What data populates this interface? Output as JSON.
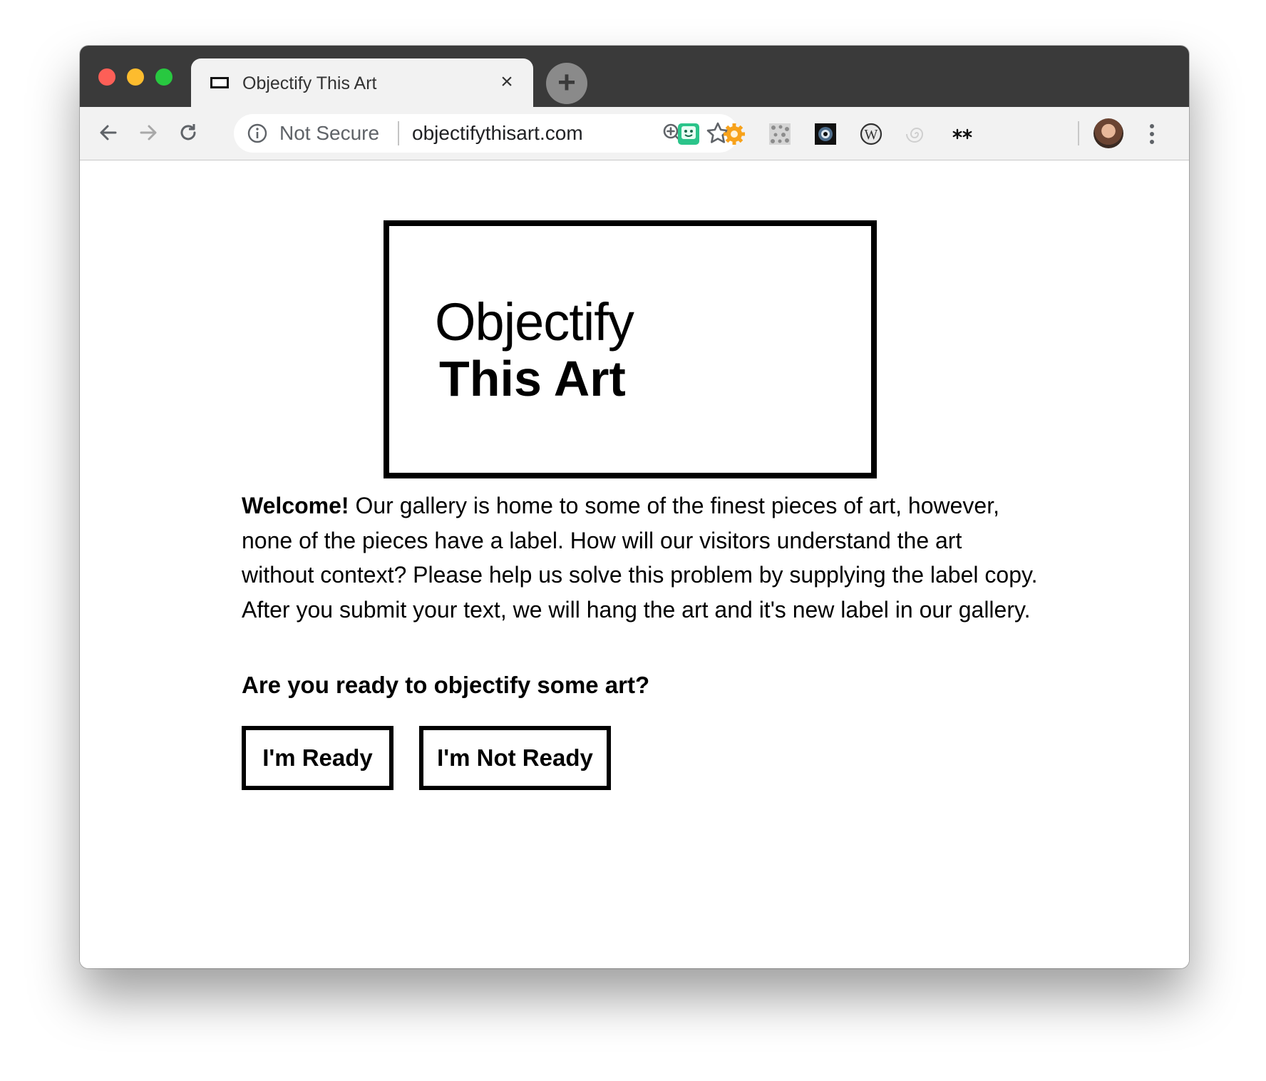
{
  "browser": {
    "tab": {
      "title": "Objectify This Art"
    },
    "omnibox": {
      "security_label": "Not Secure",
      "url": "objectifythisart.com"
    },
    "extensions": [
      "face-ext-icon",
      "gear-ext-icon",
      "pattern-ext-icon",
      "eye-ext-icon",
      "w-ext-icon",
      "spiral-ext-icon",
      "asterisks-ext-icon"
    ]
  },
  "page": {
    "logo": {
      "line1": "Objectify",
      "line2": "This Art"
    },
    "intro": {
      "lead": "Welcome!",
      "body": " Our gallery is home to some of the finest pieces of art, however, none of the pieces have a label. How will our visitors understand the art without context? Please help us solve this problem by supplying the label copy. After you submit your text, we will hang the art and it's new label in our gallery."
    },
    "question": "Are you ready to objectify some art?",
    "buttons": {
      "ready": "I'm Ready",
      "not_ready": "I'm Not Ready"
    }
  }
}
